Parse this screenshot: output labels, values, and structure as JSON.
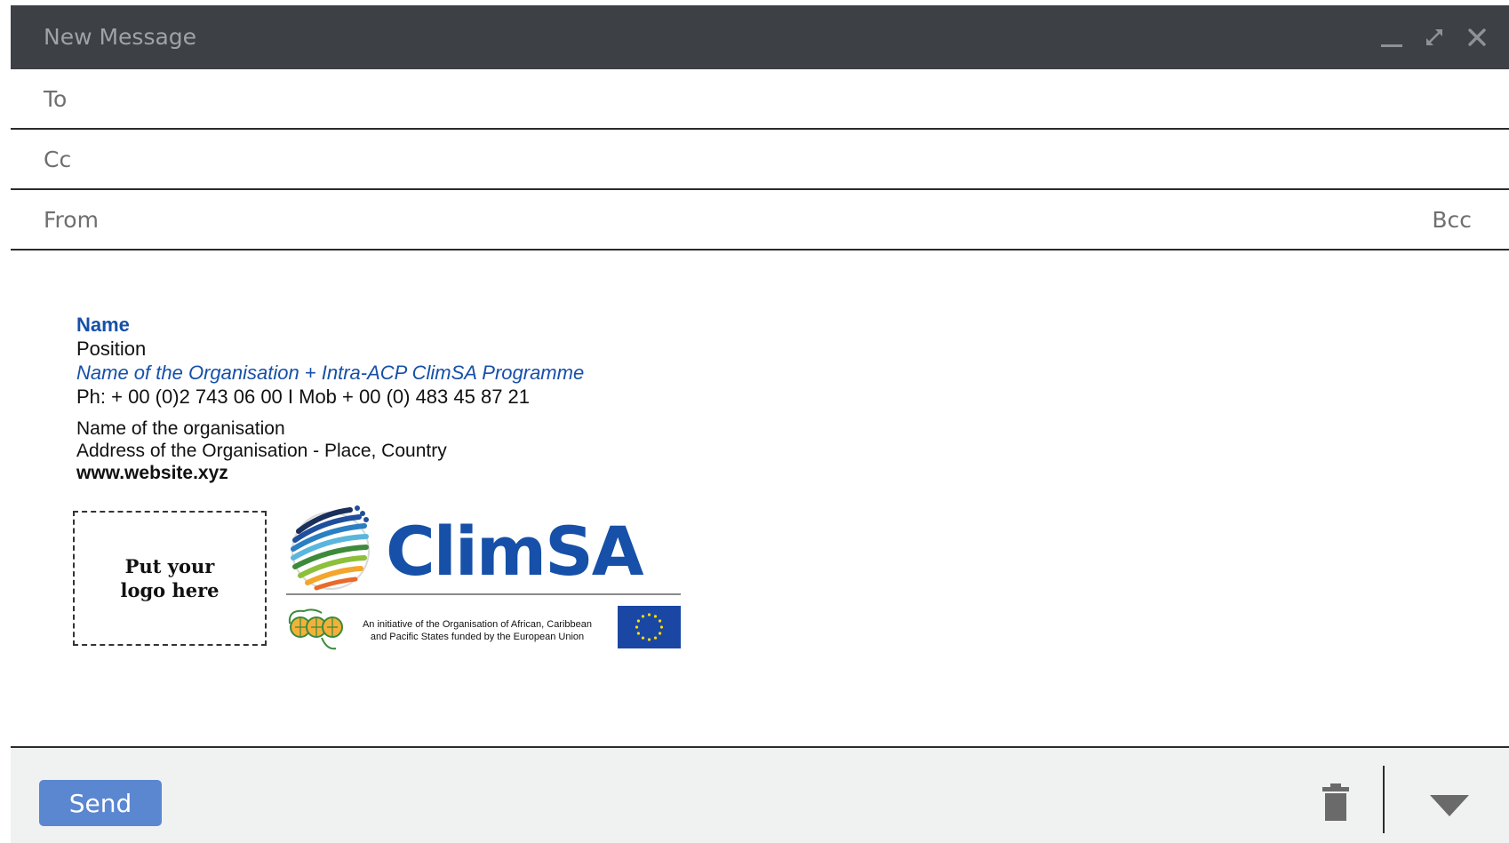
{
  "window": {
    "title": "New Message",
    "controls": [
      "minimize-icon",
      "expand-icon",
      "close-icon"
    ]
  },
  "fields": {
    "to_label": "To",
    "cc_label": "Cc",
    "from_label": "From",
    "bcc_label": "Bcc"
  },
  "signature": {
    "name": "Name",
    "position": "Position",
    "org_programme": "Name of the Organisation + Intra-ACP ClimSA Programme",
    "phone": "Ph: + 00 (0)2 743 06 00  I Mob + 00 (0) 483 45 87 21",
    "org_name": "Name of the organisation",
    "address": "Address of the Organisation - Place, Country",
    "website": "www.website.xyz",
    "logo_placeholder_line1": "Put your",
    "logo_placeholder_line2": "logo here"
  },
  "branding": {
    "climsa_wordmark": "ClimSA",
    "initiative_line1": "An initiative of the Organisation of African, Caribbean",
    "initiative_line2": "and Pacific States funded by the European Union",
    "brand_color": "#1650a8",
    "eu_flag_color": "#1a47a4",
    "eu_star_color": "#ffdd00"
  },
  "footer": {
    "send_label": "Send",
    "send_color": "#5b87d1",
    "icons": [
      "trash-icon",
      "dropdown-arrow-icon"
    ]
  },
  "colors": {
    "titlebar_bg": "#3d4044",
    "footer_bg": "#f0f1f1",
    "label_gray": "#6f6f6f"
  }
}
